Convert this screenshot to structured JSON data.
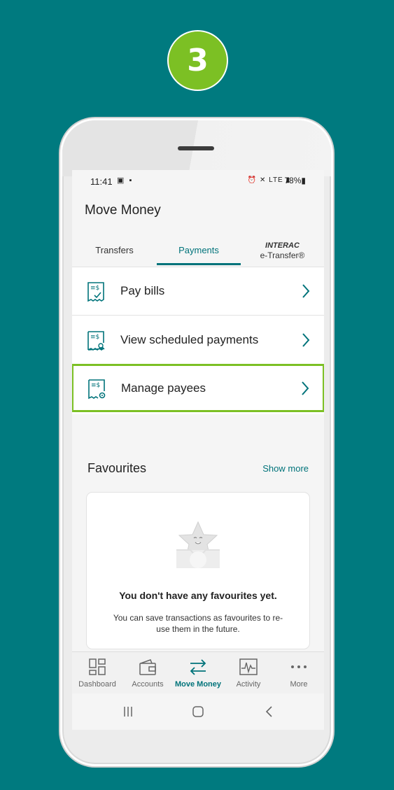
{
  "step": {
    "number": "3"
  },
  "status_bar": {
    "time": "11:41",
    "left_icons": "▣ ▪",
    "right_icons": "⏰ ✕ LTE ▮",
    "battery": "78%▮"
  },
  "page": {
    "title": "Move Money"
  },
  "tabs": [
    {
      "label": "Transfers"
    },
    {
      "label": "Payments",
      "active": true
    },
    {
      "label_top": "INTERAC",
      "label_bottom": "e-Transfer®"
    }
  ],
  "menu": [
    {
      "label": "Pay bills",
      "icon": "bill-check-icon"
    },
    {
      "label": "View scheduled payments",
      "icon": "bill-search-icon"
    },
    {
      "label": "Manage payees",
      "icon": "bill-gear-icon",
      "highlighted": true
    }
  ],
  "favourites": {
    "title": "Favourites",
    "show_more": "Show more",
    "empty_title": "You don't have any favourites yet.",
    "empty_desc": "You can save transactions as favourites to re-use them in the future."
  },
  "bottom_nav": [
    {
      "label": "Dashboard",
      "icon": "dashboard-icon"
    },
    {
      "label": "Accounts",
      "icon": "wallet-icon"
    },
    {
      "label": "Move Money",
      "icon": "transfer-arrows-icon",
      "active": true
    },
    {
      "label": "Activity",
      "icon": "activity-chart-icon"
    },
    {
      "label": "More",
      "icon": "more-dots-icon"
    }
  ],
  "colors": {
    "background": "#007a7f",
    "accent_green": "#7cc024",
    "brand_teal": "#00737a"
  }
}
